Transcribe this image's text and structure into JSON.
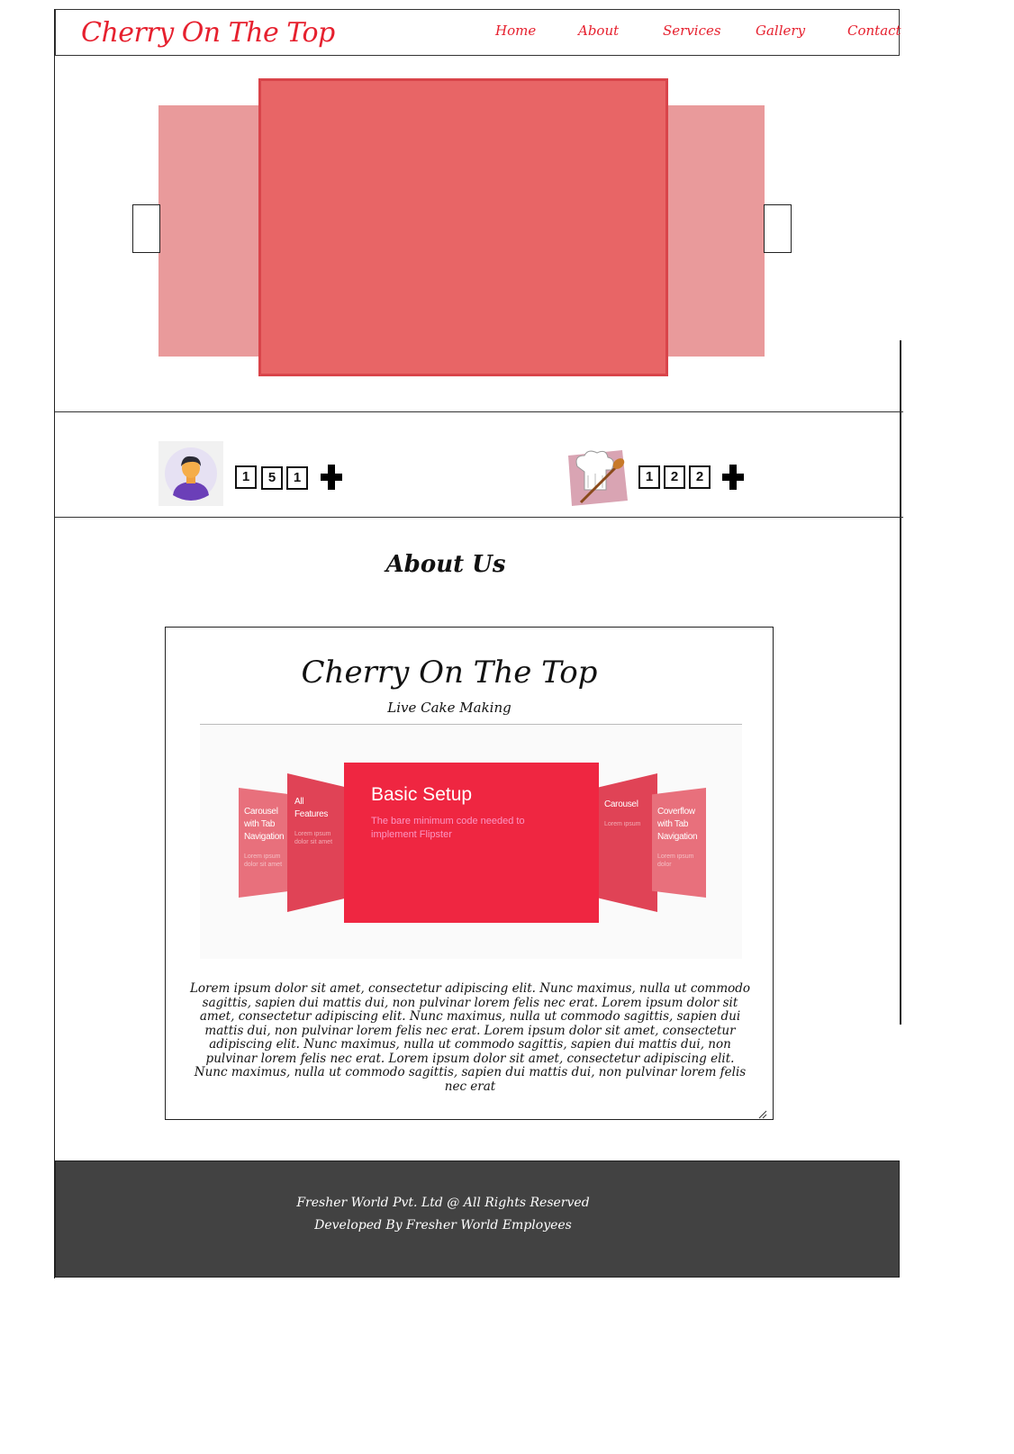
{
  "header": {
    "brand": "Cherry On The Top",
    "nav": [
      {
        "label": "Home"
      },
      {
        "label": "About"
      },
      {
        "label": "Services"
      },
      {
        "label": "Gallery"
      },
      {
        "label": "Contact"
      }
    ]
  },
  "counters": [
    {
      "icon": "user-avatar-icon",
      "digits": [
        "1",
        "5",
        "1"
      ]
    },
    {
      "icon": "chef-hat-spoon-icon",
      "digits": [
        "1",
        "2",
        "2"
      ]
    }
  ],
  "about": {
    "title": "About Us",
    "brand": "Cherry On The Top",
    "subtitle": "Live Cake Making",
    "flipster": {
      "main_title": "Basic Setup",
      "main_desc": "The bare minimum code needed to implement Flipster",
      "left_far": "Carousel with Tab Navigation",
      "left_near": "All Features",
      "right_near": "Carousel",
      "right_far": "Coverflow with Tab Navigation"
    },
    "text": "Lorem ipsum dolor sit amet, consectetur adipiscing elit. Nunc maximus, nulla ut commodo sagittis, sapien dui mattis dui, non pulvinar lorem felis nec erat. Lorem ipsum dolor sit amet, consectetur adipiscing elit. Nunc maximus, nulla ut commodo sagittis, sapien dui mattis dui, non pulvinar lorem felis nec erat. Lorem ipsum dolor sit amet, consectetur adipiscing elit. Nunc maximus, nulla ut commodo sagittis, sapien dui mattis dui, non pulvinar lorem felis nec erat. Lorem ipsum dolor sit amet, consectetur adipiscing elit. Nunc maximus, nulla ut commodo sagittis, sapien dui mattis dui, non pulvinar lorem felis nec erat"
  },
  "footer": {
    "line1": "Fresher World Pvt. Ltd @ All Rights Reserved",
    "line2": "Developed By Fresher World Employees"
  },
  "colors": {
    "accent": "#e6202e",
    "slide_main": "#e86566",
    "slide_side": "#e99a9b",
    "footer_bg": "#424242"
  }
}
